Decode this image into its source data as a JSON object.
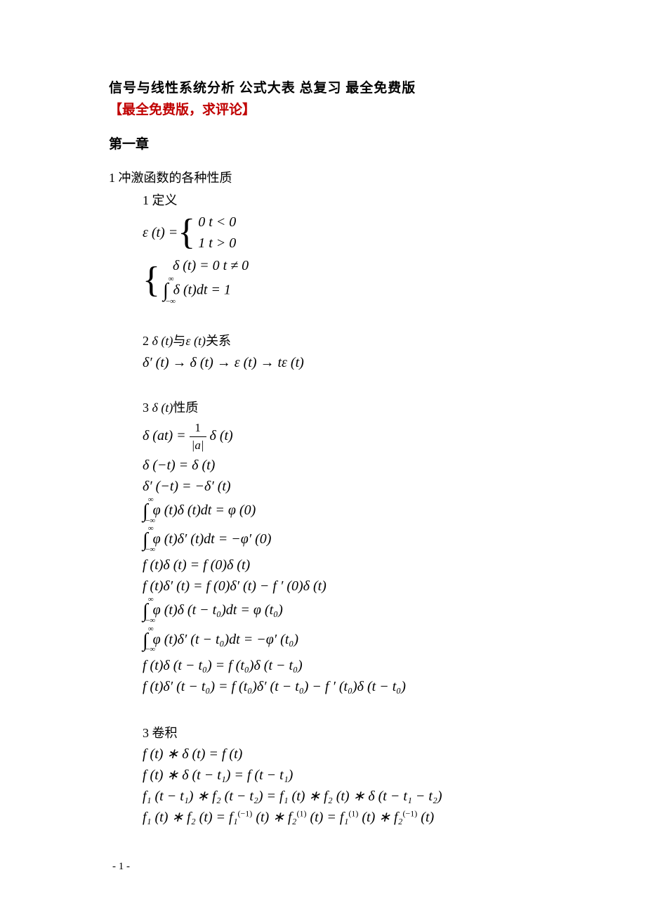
{
  "header": {
    "title": "信号与线性系统分析 公式大表 总复习 最全免费版",
    "subtitle": "【最全免费版，求评论】",
    "chapter": "第一章"
  },
  "section1": {
    "heading": "1 冲激函数的各种性质",
    "sub1": {
      "label": "1  定义",
      "eq1_row1": "0    t < 0",
      "eq1_row2": "1    t > 0",
      "eq1_left": "ε (t) = ",
      "eq2_row1": "δ (t) = 0       t ≠ 0",
      "eq2_row2_after": " δ (t)dt = 1"
    },
    "sub2": {
      "label_prefix": "2   ",
      "label_math": "δ (t)",
      "label_mid": "与",
      "label_math2": "ε (t)",
      "label_suffix": "关系",
      "chain": "δ′ (t) → δ (t) → ε (t) → tε (t)"
    },
    "sub3": {
      "label_prefix": "3   ",
      "label_math": "δ (t)",
      "label_suffix": "性质",
      "eqs": [
        "δ (at) = ",
        "δ (−t) = δ (t)",
        "δ′ (−t) = −δ′ (t)",
        "",
        "",
        "f (t)δ (t) = f (0)δ (t)",
        "f (t)δ′ (t) = f (0)δ′ (t) − f ′ (0)δ (t)",
        "",
        "",
        "f (t)δ (t − t₀) = f (t₀)δ (t − t₀)",
        "f (t)δ′ (t − t₀) = f (t₀)δ′ (t − t₀) − f ′ (t₀)δ (t − t₀)"
      ],
      "int_eq1_after": " φ (t)δ (t)dt = φ (0)",
      "int_eq2_after": " φ (t)δ′ (t)dt = −φ′ (0)",
      "int_eq3_after": " φ (t)δ (t − t₀)dt = φ (t₀)",
      "int_eq4_after": " φ (t)δ′ (t − t₀)dt = −φ′ (t₀)",
      "frac_num": "1",
      "frac_den": "|a|",
      "frac_after": " δ (t)"
    },
    "sub4": {
      "label": "3   卷积",
      "eqs": [
        "f (t) ∗ δ (t) = f (t)",
        "f (t) ∗ δ (t − t₁) = f (t − t₁)",
        "f₁ (t − t₁) ∗ f₂ (t − t₂) = f₁ (t) ∗ f₂ (t) ∗ δ (t − t₁ − t₂)"
      ],
      "eq4_parts": {
        "p1": "f₁ (t) ∗ f₂ (t) = f₁",
        "sup1": "(−1)",
        "p2": " (t) ∗ f₂",
        "sup2": "(1)",
        "p3": " (t) = f₁",
        "sup3": "(1)",
        "p4": " (t) ∗ f₂",
        "sup4": "(−1)",
        "p5": " (t)"
      }
    }
  },
  "footer": {
    "page": "- 1 -"
  }
}
